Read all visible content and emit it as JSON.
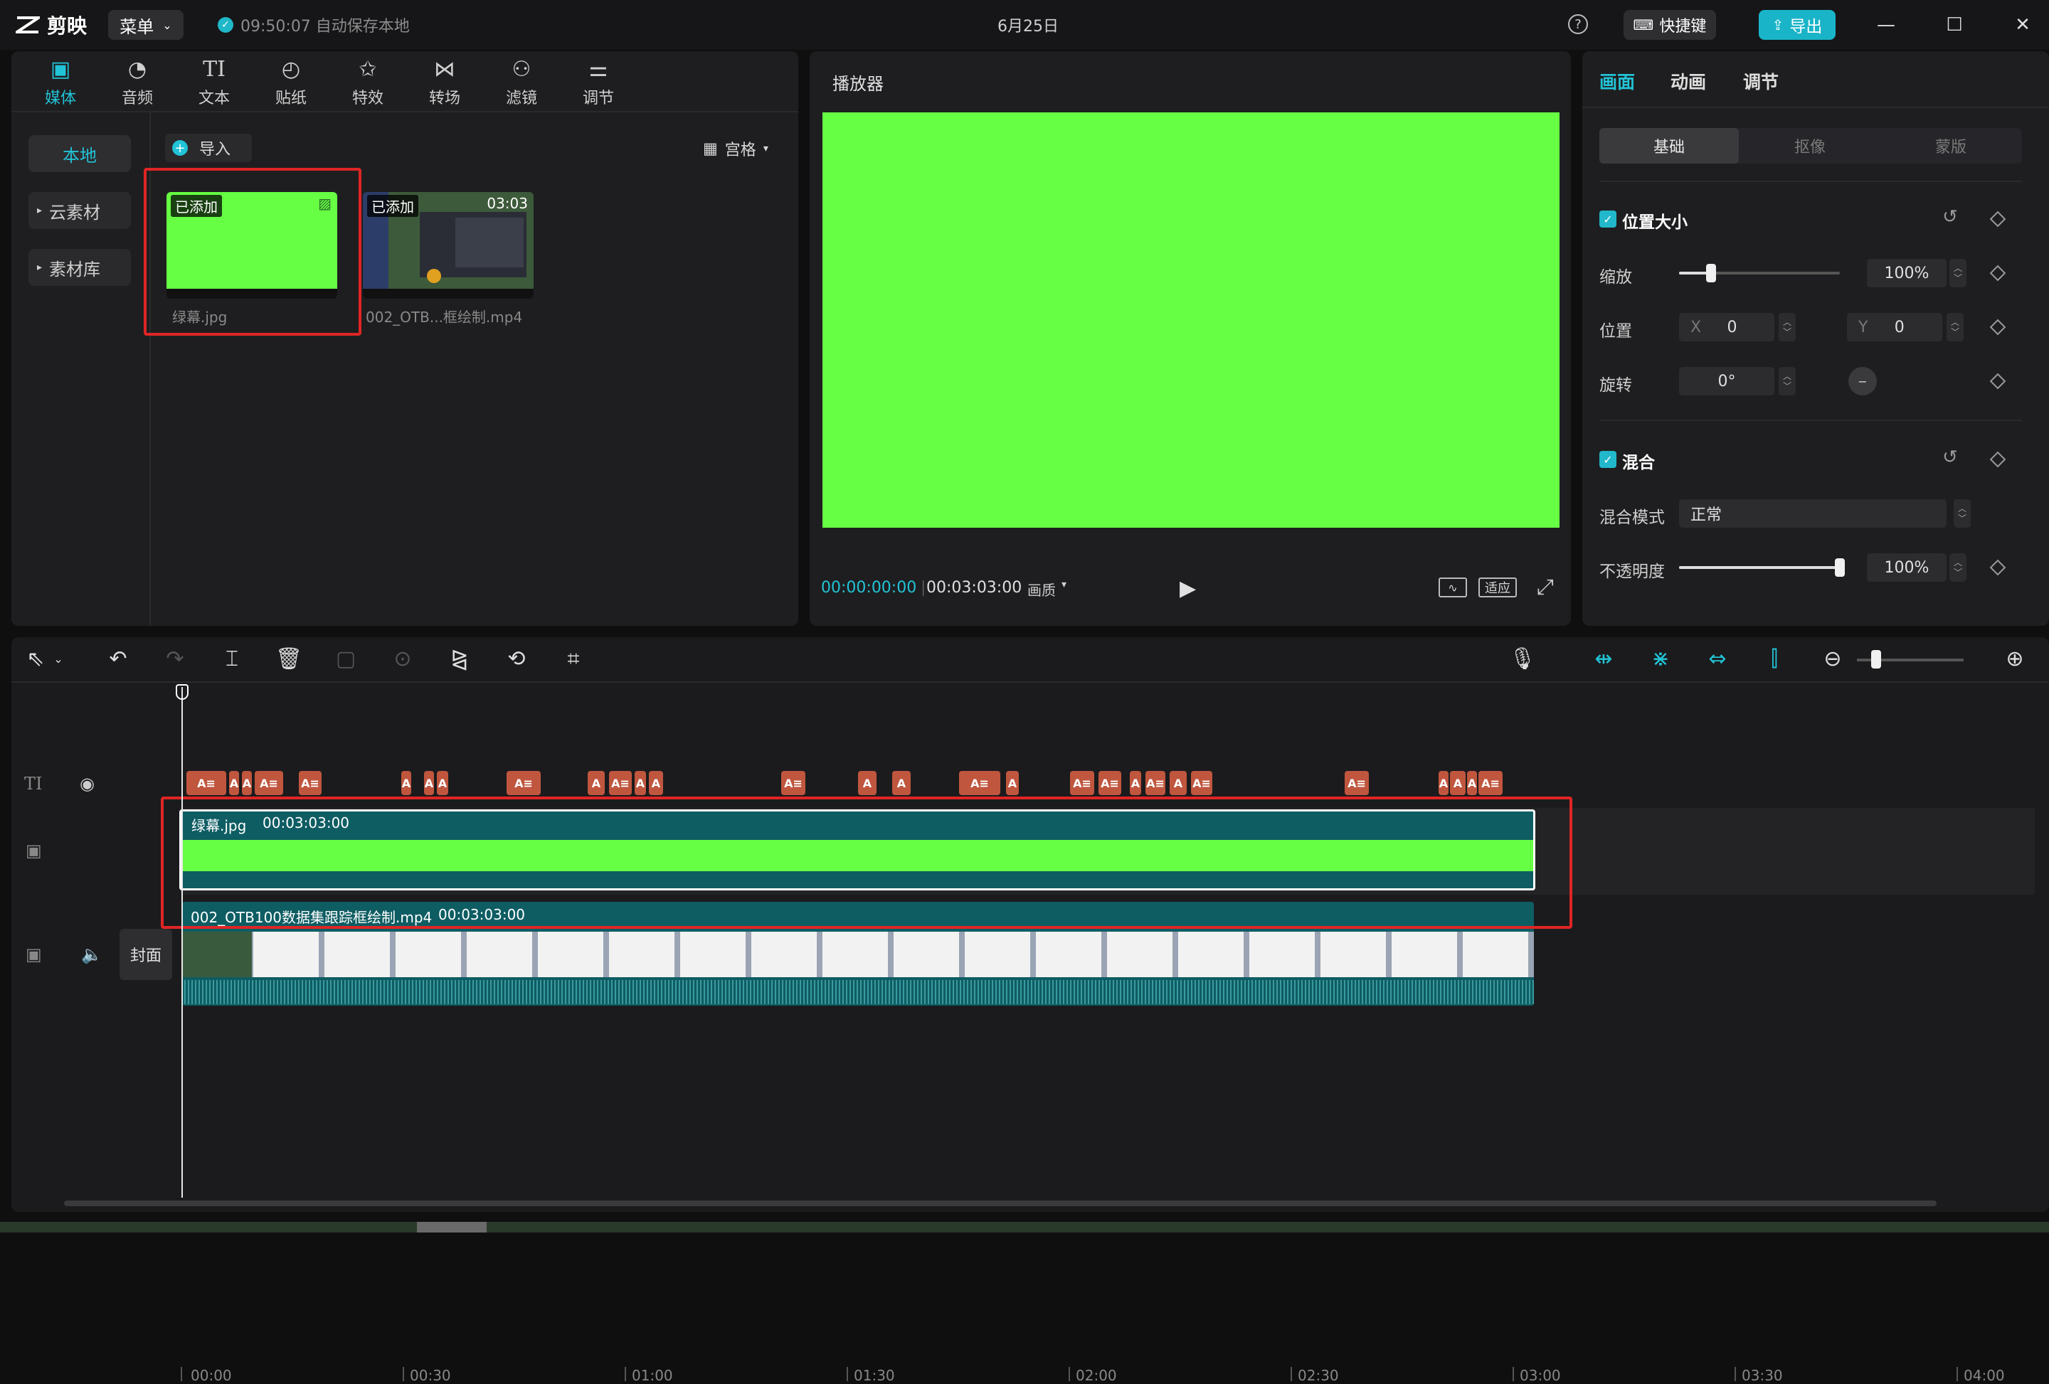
{
  "app": {
    "name": "剪映",
    "menu_label": "菜单",
    "save_status": "09:50:07 自动保存本地",
    "title": "6月25日",
    "shortcut_label": "快捷键",
    "export_label": "导出"
  },
  "media_tabs": [
    {
      "label": "媒体",
      "icon": "media-icon",
      "active": true
    },
    {
      "label": "音频",
      "icon": "audio-icon"
    },
    {
      "label": "文本",
      "icon": "text-icon"
    },
    {
      "label": "贴纸",
      "icon": "sticker-icon"
    },
    {
      "label": "特效",
      "icon": "effects-icon"
    },
    {
      "label": "转场",
      "icon": "transition-icon"
    },
    {
      "label": "滤镜",
      "icon": "filter-icon"
    },
    {
      "label": "调节",
      "icon": "adjust-icon"
    }
  ],
  "media_sidebar": {
    "local": "本地",
    "cloud": "云素材",
    "library": "素材库"
  },
  "media_toolbar": {
    "import": "导入",
    "view": "宫格"
  },
  "media_items": [
    {
      "badge": "已添加",
      "name": "绿幕.jpg",
      "duration": "",
      "color": "#66ff44"
    },
    {
      "badge": "已添加",
      "name": "002_OTB...框绘制.mp4",
      "duration": "03:03"
    }
  ],
  "player": {
    "title": "播放器",
    "current_time": "00:00:00:00",
    "total_time": "00:03:03:00",
    "quality": "画质",
    "fit": "适应",
    "screen_color": "#66ff44"
  },
  "inspector": {
    "tabs": [
      "画面",
      "动画",
      "调节"
    ],
    "segments": [
      "基础",
      "抠像",
      "蒙版"
    ],
    "position_size": {
      "title": "位置大小",
      "scale_label": "缩放",
      "scale_value": "100%",
      "scale_level": 0.2,
      "position_label": "位置",
      "x_label": "X",
      "x_value": "0",
      "y_label": "Y",
      "y_value": "0",
      "rotate_label": "旋转",
      "rotate_value": "0°"
    },
    "blend": {
      "title": "混合",
      "mode_label": "混合模式",
      "mode_value": "正常",
      "opacity_label": "不透明度",
      "opacity_value": "100%",
      "opacity_level": 1.0
    }
  },
  "timeline": {
    "ruler": [
      "00:00",
      "00:30",
      "01:00",
      "01:30",
      "02:00",
      "02:30",
      "03:00",
      "03:30",
      "04:00"
    ],
    "green_clip": {
      "name": "绿幕.jpg",
      "duration": "00:03:03:00",
      "color": "#66ff44"
    },
    "video_clip": {
      "name": "002_OTB100数据集跟踪框绘制.mp4",
      "duration": "00:03:03:00"
    },
    "cover_label": "封面",
    "text_clip_label": "A≡",
    "text_clip_short_label": "A"
  },
  "colors": {
    "accent": "#22c3d6",
    "highlight": "#e02525",
    "text_clip": "#c0563e",
    "track_teal": "#0e5d63"
  }
}
